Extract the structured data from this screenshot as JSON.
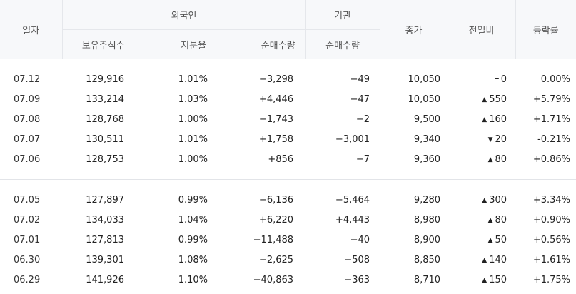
{
  "header": {
    "date": "일자",
    "foreign": "외국인",
    "foreign_hold": "보유주식수",
    "foreign_ratio": "지분율",
    "foreign_net": "순매수량",
    "institution": "기관",
    "institution_net": "순매수량",
    "close": "종가",
    "diff": "전일비",
    "rate": "등락률"
  },
  "colors": {
    "up": "#e12343",
    "down": "#1a5bbf",
    "header_bg": "#f7f8fa"
  },
  "rows_group1": [
    {
      "date": "07.12",
      "hold": "129,916",
      "ratio": "1.01%",
      "fnet": "−3,298",
      "fnet_dir": "down",
      "inet": "−49",
      "inet_dir": "down",
      "close": "10,050",
      "close_dir": "flat",
      "arrow": "flat",
      "diff": "0",
      "rate": "0.00%",
      "rate_dir": "flat"
    },
    {
      "date": "07.09",
      "hold": "133,214",
      "ratio": "1.03%",
      "fnet": "+4,446",
      "fnet_dir": "up",
      "inet": "−47",
      "inet_dir": "down",
      "close": "10,050",
      "close_dir": "up",
      "arrow": "up",
      "diff": "550",
      "rate": "+5.79%",
      "rate_dir": "up"
    },
    {
      "date": "07.08",
      "hold": "128,768",
      "ratio": "1.00%",
      "fnet": "−1,743",
      "fnet_dir": "down",
      "inet": "−2",
      "inet_dir": "down",
      "close": "9,500",
      "close_dir": "up",
      "arrow": "up",
      "diff": "160",
      "rate": "+1.71%",
      "rate_dir": "up"
    },
    {
      "date": "07.07",
      "hold": "130,511",
      "ratio": "1.01%",
      "fnet": "+1,758",
      "fnet_dir": "up",
      "inet": "−3,001",
      "inet_dir": "down",
      "close": "9,340",
      "close_dir": "down",
      "arrow": "down",
      "diff": "20",
      "rate": "-0.21%",
      "rate_dir": "down"
    },
    {
      "date": "07.06",
      "hold": "128,753",
      "ratio": "1.00%",
      "fnet": "+856",
      "fnet_dir": "up",
      "inet": "−7",
      "inet_dir": "down",
      "close": "9,360",
      "close_dir": "up",
      "arrow": "up",
      "diff": "80",
      "rate": "+0.86%",
      "rate_dir": "up"
    }
  ],
  "rows_group2": [
    {
      "date": "07.05",
      "hold": "127,897",
      "ratio": "0.99%",
      "fnet": "−6,136",
      "fnet_dir": "down",
      "inet": "−5,464",
      "inet_dir": "down",
      "close": "9,280",
      "close_dir": "up",
      "arrow": "up",
      "diff": "300",
      "rate": "+3.34%",
      "rate_dir": "up"
    },
    {
      "date": "07.02",
      "hold": "134,033",
      "ratio": "1.04%",
      "fnet": "+6,220",
      "fnet_dir": "up",
      "inet": "+4,443",
      "inet_dir": "up",
      "close": "8,980",
      "close_dir": "up",
      "arrow": "up",
      "diff": "80",
      "rate": "+0.90%",
      "rate_dir": "up"
    },
    {
      "date": "07.01",
      "hold": "127,813",
      "ratio": "0.99%",
      "fnet": "−11,488",
      "fnet_dir": "down",
      "inet": "−40",
      "inet_dir": "down",
      "close": "8,900",
      "close_dir": "up",
      "arrow": "up",
      "diff": "50",
      "rate": "+0.56%",
      "rate_dir": "up"
    },
    {
      "date": "06.30",
      "hold": "139,301",
      "ratio": "1.08%",
      "fnet": "−2,625",
      "fnet_dir": "down",
      "inet": "−508",
      "inet_dir": "down",
      "close": "8,850",
      "close_dir": "up",
      "arrow": "up",
      "diff": "140",
      "rate": "+1.61%",
      "rate_dir": "up"
    },
    {
      "date": "06.29",
      "hold": "141,926",
      "ratio": "1.10%",
      "fnet": "−40,863",
      "fnet_dir": "down",
      "inet": "−363",
      "inet_dir": "down",
      "close": "8,710",
      "close_dir": "up",
      "arrow": "up",
      "diff": "150",
      "rate": "+1.75%",
      "rate_dir": "up"
    }
  ]
}
